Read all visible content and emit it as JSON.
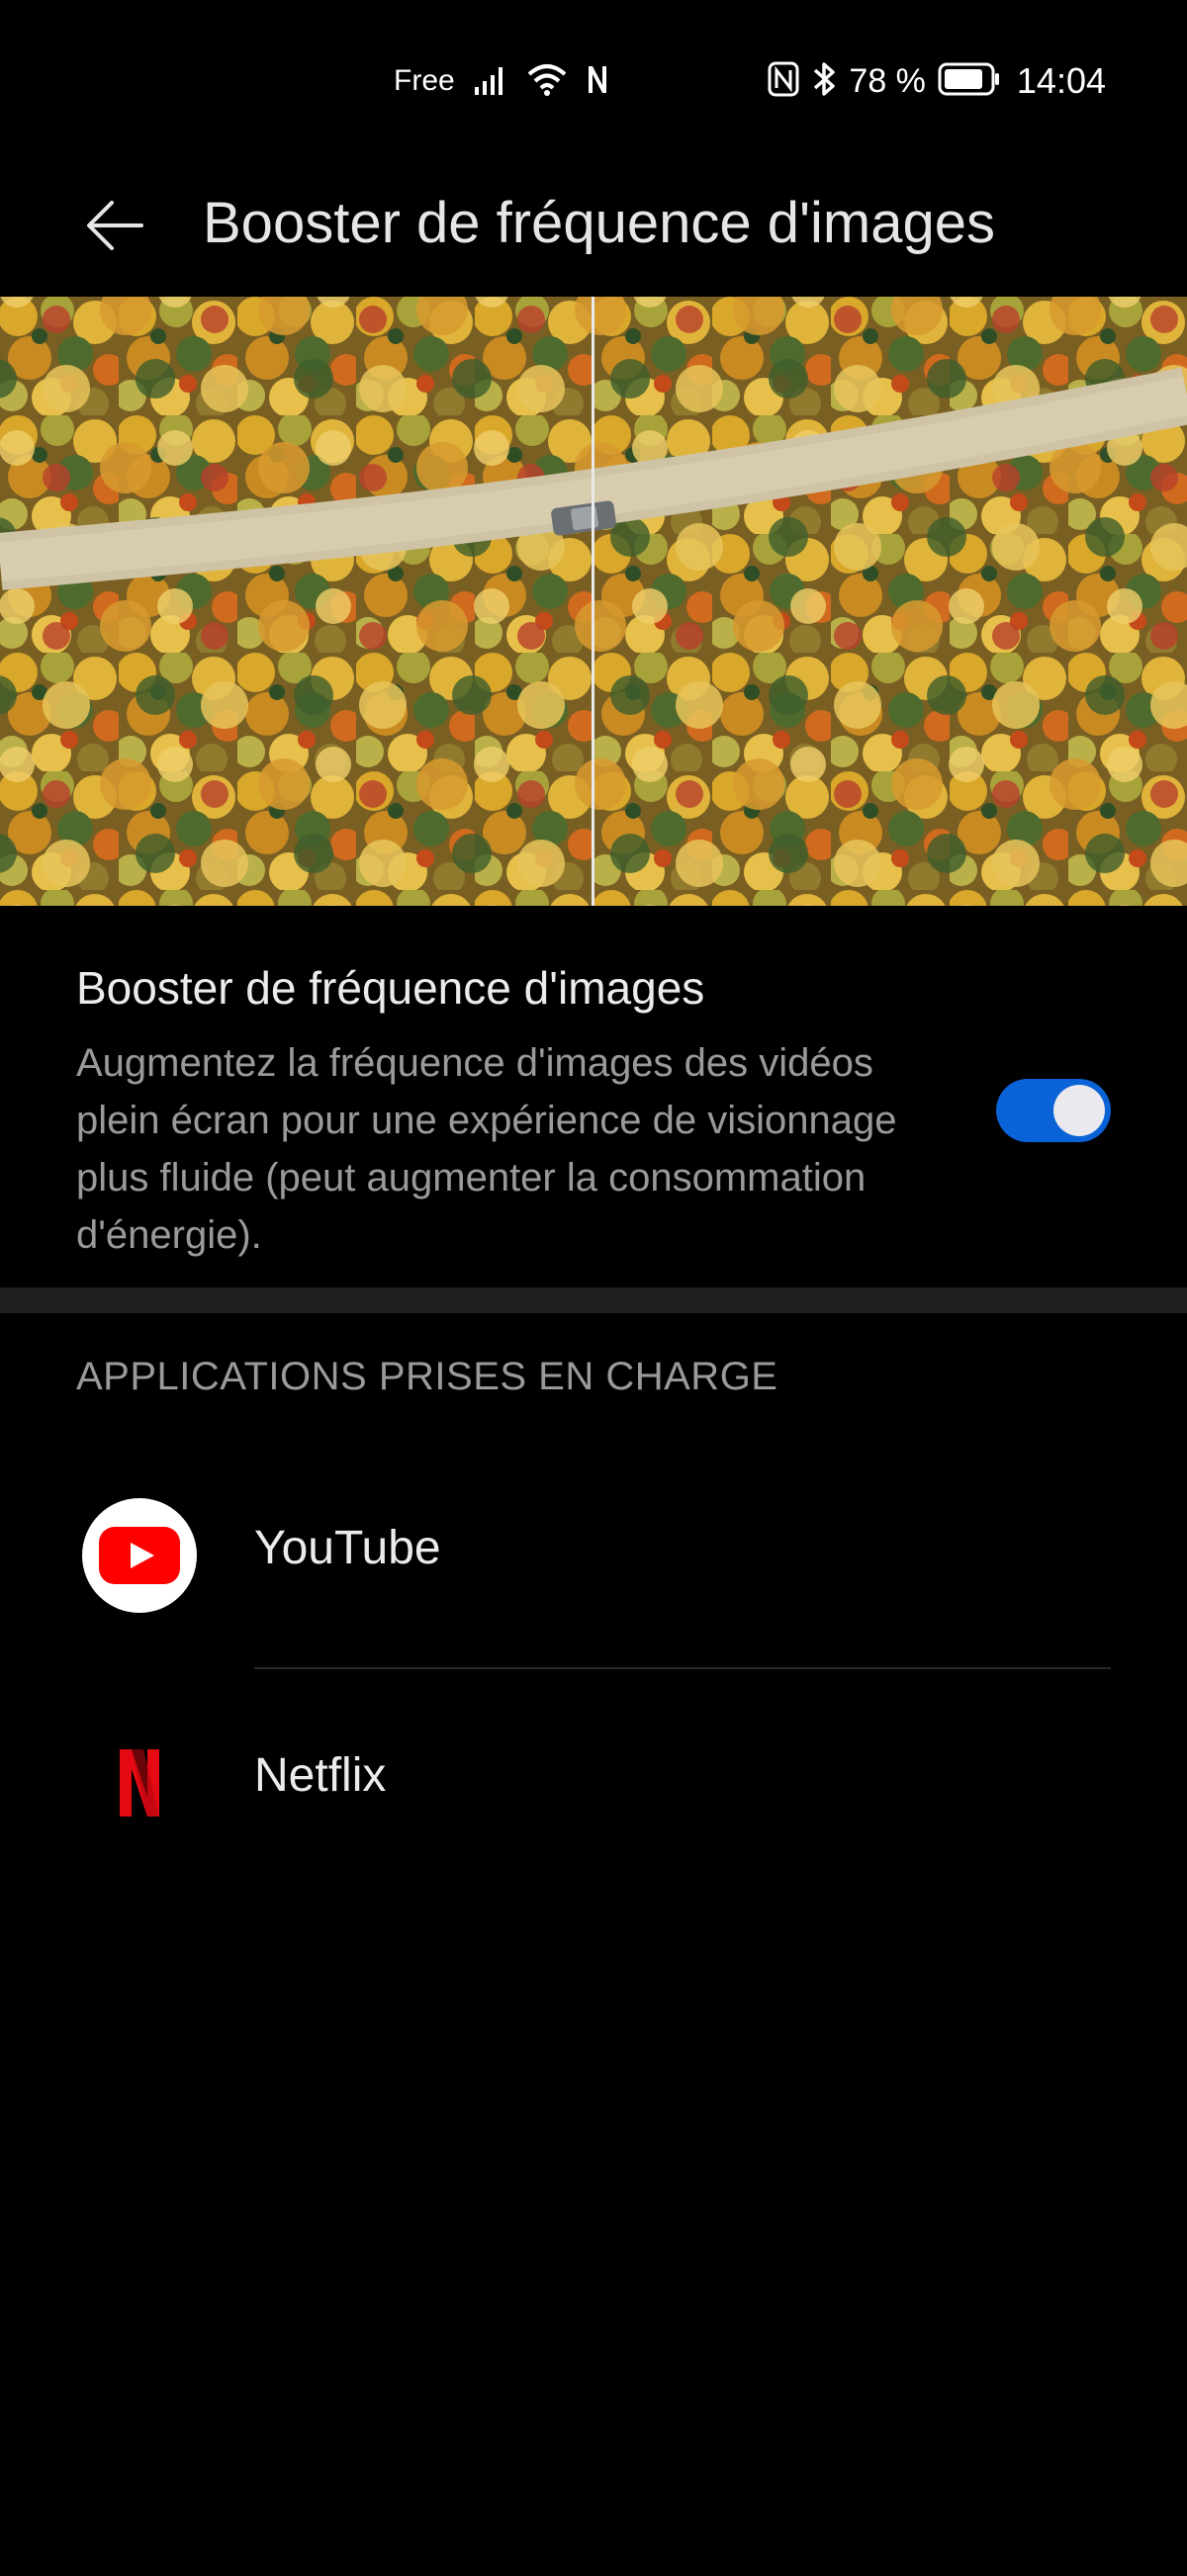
{
  "status_bar": {
    "carrier": "Free",
    "battery_percent": "78 %",
    "time": "14:04",
    "icons": [
      "signal-icon",
      "wifi-icon",
      "n-notification-icon",
      "nfc-icon",
      "bluetooth-icon",
      "battery-icon"
    ]
  },
  "header": {
    "title": "Booster de fréquence d'images",
    "back_icon": "arrow-left-icon"
  },
  "setting": {
    "title": "Booster de fréquence d'images",
    "description": "Augmentez la fréquence d'images des vidéos plein écran pour une expérience de visionnage plus fluide (peut augmenter la consommation d'énergie).",
    "enabled": true,
    "accent_color": "#0a63d6"
  },
  "supported_apps": {
    "header": "APPLICATIONS PRISES EN CHARGE",
    "items": [
      {
        "name": "YouTube",
        "icon": "youtube-icon",
        "color": "#ff0000"
      },
      {
        "name": "Netflix",
        "icon": "netflix-icon",
        "color": "#e50914"
      }
    ]
  }
}
